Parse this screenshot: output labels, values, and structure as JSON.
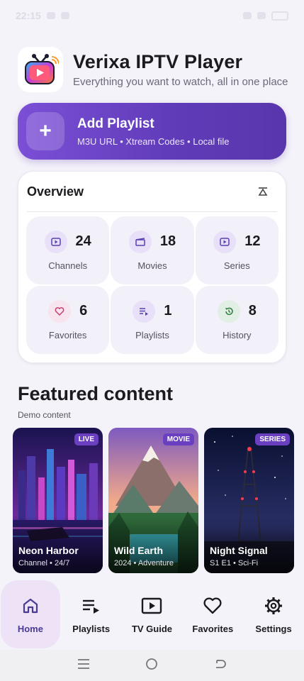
{
  "status_bar": {
    "time": "22:15"
  },
  "header": {
    "title": "Verixa IPTV Player",
    "subtitle": "Everything you want to watch, all in one place"
  },
  "add_playlist": {
    "icon": "+",
    "title": "Add Playlist",
    "subtitle": "M3U URL • Xtream Codes • Local file"
  },
  "overview": {
    "title": "Overview",
    "stats": [
      {
        "label": "Channels",
        "value": "24",
        "icon": "play-box-icon"
      },
      {
        "label": "Movies",
        "value": "18",
        "icon": "clapper-icon"
      },
      {
        "label": "Series",
        "value": "12",
        "icon": "play-box-icon"
      },
      {
        "label": "Favorites",
        "value": "6",
        "icon": "heart-icon"
      },
      {
        "label": "Playlists",
        "value": "1",
        "icon": "playlist-icon"
      },
      {
        "label": "History",
        "value": "8",
        "icon": "history-icon"
      }
    ]
  },
  "featured": {
    "title": "Featured content",
    "subtitle": "Demo content",
    "cards": [
      {
        "badge": "LIVE",
        "title": "Neon Harbor",
        "meta": "Channel • 24/7"
      },
      {
        "badge": "MOVIE",
        "title": "Wild Earth",
        "meta": "2024 • Adventure"
      },
      {
        "badge": "SERIES",
        "title": "Night Signal",
        "meta": "S1 E1 • Sci-Fi"
      }
    ]
  },
  "nav": {
    "items": [
      {
        "label": "Home",
        "icon": "home-icon",
        "active": true
      },
      {
        "label": "Playlists",
        "icon": "playlist-icon"
      },
      {
        "label": "TV Guide",
        "icon": "tv-guide-icon"
      },
      {
        "label": "Favorites",
        "icon": "heart-icon"
      },
      {
        "label": "Settings",
        "icon": "gear-icon"
      }
    ]
  },
  "colors": {
    "accent": "#6a3fc0",
    "add_gradient_start": "#7b4fd6",
    "add_gradient_end": "#5a36ad",
    "background": "#f5f3fa"
  }
}
